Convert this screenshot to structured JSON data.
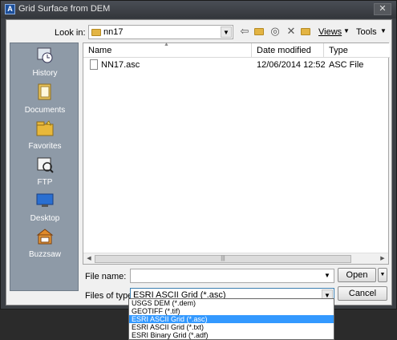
{
  "window": {
    "title": "Grid Surface from DEM",
    "close_glyph": "✕"
  },
  "toolbar": {
    "look_in_label": "Look in:",
    "look_in_value": "nn17",
    "views_label": "Views",
    "tools_label": "Tools"
  },
  "places": [
    {
      "label": "History",
      "icon": "history-icon"
    },
    {
      "label": "Documents",
      "icon": "documents-icon"
    },
    {
      "label": "Favorites",
      "icon": "favorites-icon"
    },
    {
      "label": "FTP",
      "icon": "ftp-icon"
    },
    {
      "label": "Desktop",
      "icon": "desktop-icon"
    },
    {
      "label": "Buzzsaw",
      "icon": "buzzsaw-icon"
    }
  ],
  "file_list": {
    "columns": [
      "Name",
      "Date modified",
      "Type"
    ],
    "rows": [
      {
        "name": "NN17.asc",
        "date": "12/06/2014 12:52",
        "type": "ASC File"
      }
    ]
  },
  "form": {
    "file_name_label": "File name:",
    "file_name_value": "",
    "files_of_type_label": "Files of type:",
    "files_of_type_value": "ESRI ASCII Grid (*.asc)",
    "open_label": "Open",
    "cancel_label": "Cancel"
  },
  "type_options": [
    "USGS DEM (*.dem)",
    "GEOTIFF (*.tif)",
    "ESRI ASCII Grid (*.asc)",
    "ESRI ASCII Grid (*.txt)",
    "ESRI Binary Grid (*.adf)"
  ],
  "colors": {
    "selection": "#3399ff",
    "places_bg": "#8e9aa7"
  }
}
